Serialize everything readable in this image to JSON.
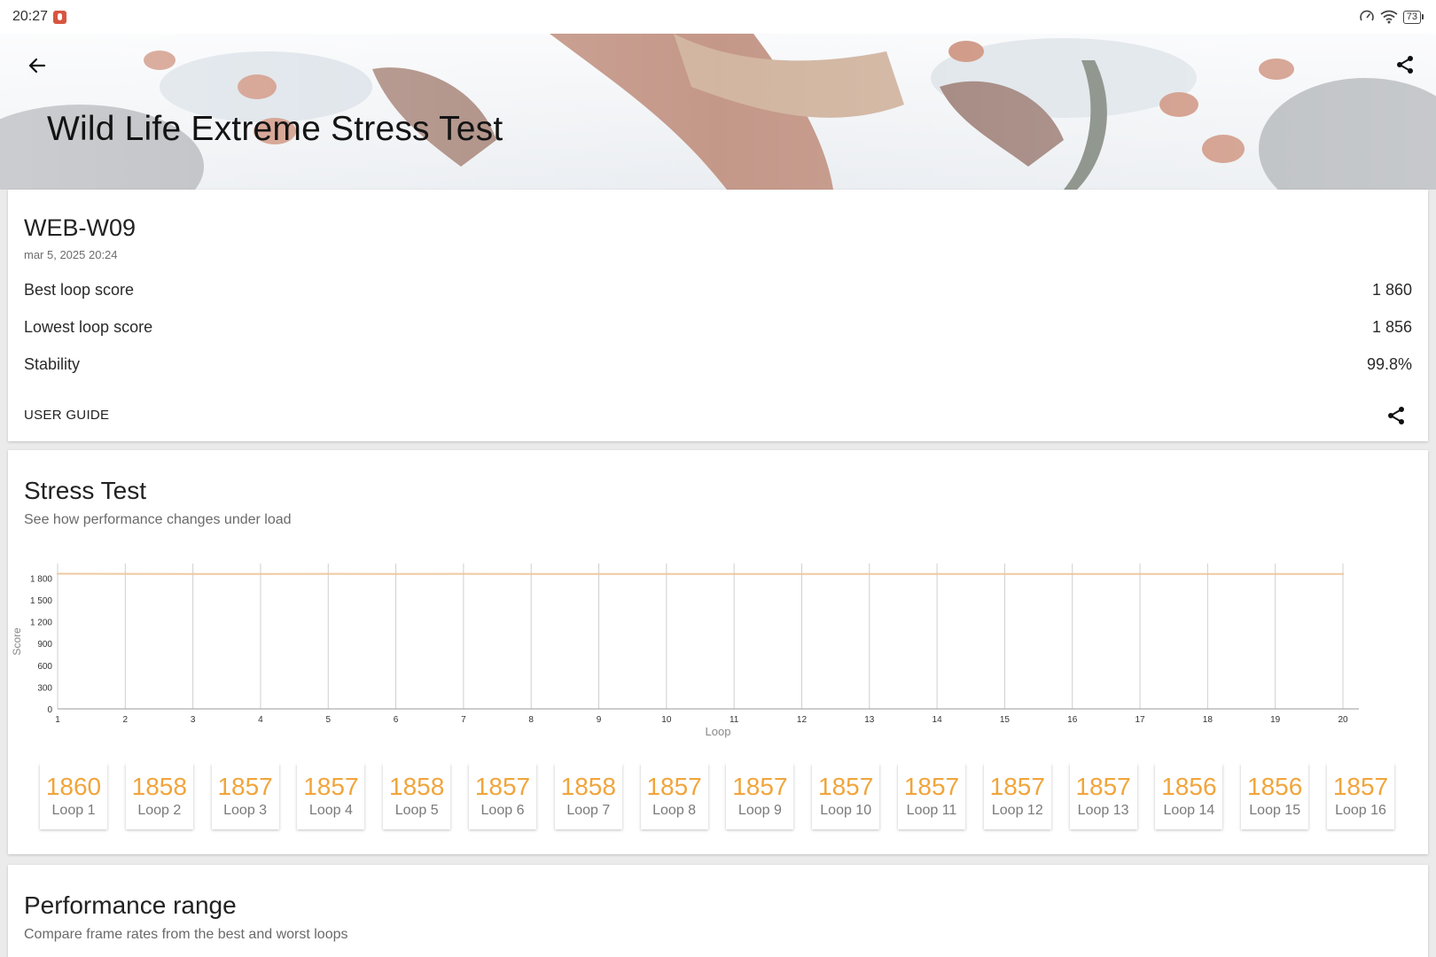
{
  "status_bar": {
    "time": "20:27",
    "battery": "73"
  },
  "header": {
    "title": "Wild Life Extreme Stress Test"
  },
  "summary": {
    "device": "WEB-W09",
    "date": "mar 5, 2025 20:24",
    "rows": [
      {
        "label": "Best loop score",
        "value": "1 860"
      },
      {
        "label": "Lowest loop score",
        "value": "1 856"
      },
      {
        "label": "Stability",
        "value": "99.8%"
      }
    ],
    "user_guide": "USER GUIDE"
  },
  "stress_test": {
    "title": "Stress Test",
    "subtitle": "See how performance changes under load",
    "loops": [
      {
        "score": "1860",
        "label": "Loop 1"
      },
      {
        "score": "1858",
        "label": "Loop 2"
      },
      {
        "score": "1857",
        "label": "Loop 3"
      },
      {
        "score": "1857",
        "label": "Loop 4"
      },
      {
        "score": "1858",
        "label": "Loop 5"
      },
      {
        "score": "1857",
        "label": "Loop 6"
      },
      {
        "score": "1858",
        "label": "Loop 7"
      },
      {
        "score": "1857",
        "label": "Loop 8"
      },
      {
        "score": "1857",
        "label": "Loop 9"
      },
      {
        "score": "1857",
        "label": "Loop 10"
      },
      {
        "score": "1857",
        "label": "Loop 11"
      },
      {
        "score": "1857",
        "label": "Loop 12"
      },
      {
        "score": "1857",
        "label": "Loop 13"
      },
      {
        "score": "1856",
        "label": "Loop 14"
      },
      {
        "score": "1856",
        "label": "Loop 15"
      },
      {
        "score": "1857",
        "label": "Loop 16"
      }
    ]
  },
  "performance_range": {
    "title": "Performance range",
    "subtitle": "Compare frame rates from the best and worst loops"
  },
  "chart_data": {
    "type": "line",
    "xlabel": "Loop",
    "ylabel": "Score",
    "x": [
      1,
      2,
      3,
      4,
      5,
      6,
      7,
      8,
      9,
      10,
      11,
      12,
      13,
      14,
      15,
      16,
      17,
      18,
      19,
      20
    ],
    "x_ticks": [
      "1",
      "2",
      "3",
      "4",
      "5",
      "6",
      "7",
      "8",
      "9",
      "10",
      "11",
      "12",
      "13",
      "14",
      "15",
      "16",
      "17",
      "18",
      "19",
      "20"
    ],
    "y_ticks": [
      "0",
      "300",
      "600",
      "900",
      "1 200",
      "1 500",
      "1 800"
    ],
    "ylim": [
      0,
      2000
    ],
    "grid": "vertical",
    "series": [
      {
        "values": [
          1860,
          1858,
          1857,
          1857,
          1858,
          1857,
          1858,
          1857,
          1857,
          1857,
          1857,
          1857,
          1857,
          1856,
          1856,
          1857,
          1857,
          1857,
          1857,
          1857
        ]
      }
    ],
    "colors": {
      "line": "#efc9a0",
      "grid": "#cfcfcf",
      "axis": "#9a9a9a"
    }
  }
}
